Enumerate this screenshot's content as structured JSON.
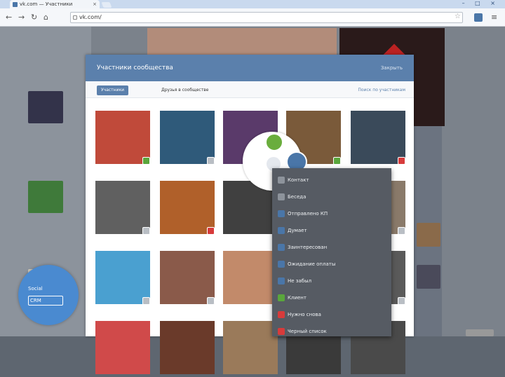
{
  "browser": {
    "tab_title": "vk.com — Участники",
    "tab_close": "×",
    "window_controls": "– □ ×",
    "url": "vk.com/",
    "icons": [
      "back-icon",
      "forward-icon",
      "reload-icon",
      "home-icon",
      "star-icon",
      "extension-icon",
      "menu-icon"
    ]
  },
  "modal": {
    "title": "Участники сообщества",
    "close": "Закрыть",
    "tabs": {
      "active": "Участники",
      "second": "Друзья в сообществе",
      "sort": "Поиск по участникам"
    }
  },
  "members": [
    {
      "name": "",
      "badge": "green"
    },
    {
      "name": "",
      "badge": "gray"
    },
    {
      "name": "",
      "badge": "none"
    },
    {
      "name": "",
      "badge": "green"
    },
    {
      "name": "",
      "badge": "red"
    },
    {
      "name": "",
      "badge": "gray"
    },
    {
      "name": "",
      "badge": "red"
    },
    {
      "name": "",
      "badge": "none"
    },
    {
      "name": "",
      "badge": "none"
    },
    {
      "name": "",
      "badge": "gray"
    },
    {
      "name": "",
      "badge": "gray"
    },
    {
      "name": "",
      "badge": "gray"
    },
    {
      "name": "",
      "badge": "none"
    },
    {
      "name": "",
      "badge": "none"
    },
    {
      "name": "",
      "badge": "gray"
    },
    {
      "name": "",
      "badge": "none"
    },
    {
      "name": "",
      "badge": "none"
    },
    {
      "name": "",
      "badge": "none"
    },
    {
      "name": "",
      "badge": "none"
    },
    {
      "name": "",
      "badge": "none"
    }
  ],
  "context_menu": [
    {
      "label": "Контакт",
      "color": "#8d939b"
    },
    {
      "label": "Беседа",
      "color": "#8d939b"
    },
    {
      "label": "Отправлено КП",
      "color": "#4a76a8"
    },
    {
      "label": "Думает",
      "color": "#4a76a8"
    },
    {
      "label": "Заинтересован",
      "color": "#4a76a8"
    },
    {
      "label": "Ожидание оплаты",
      "color": "#4a76a8"
    },
    {
      "label": "Не забыл",
      "color": "#4a76a8"
    },
    {
      "label": "Клиент",
      "color": "#5aa63c"
    },
    {
      "label": "Нужно снова",
      "color": "#d73b3b"
    },
    {
      "label": "Черный список",
      "color": "#d73b3b"
    }
  ],
  "logo": {
    "line1": "Social",
    "box": "CRM"
  }
}
